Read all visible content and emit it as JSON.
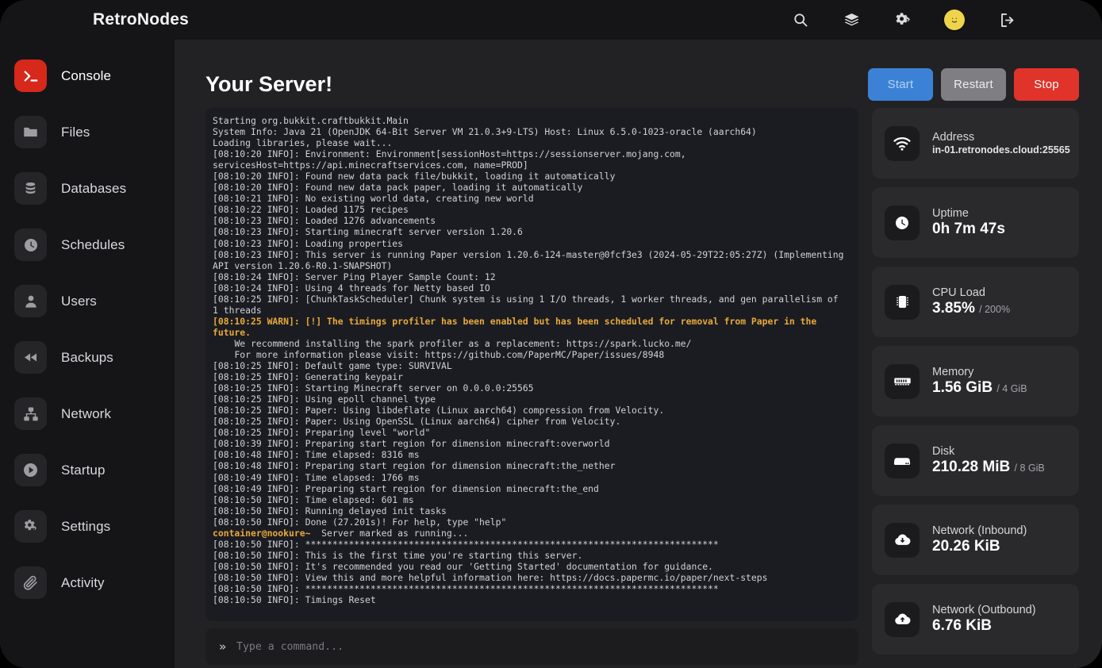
{
  "brand": "RetroNodes",
  "topbar": {
    "icons": [
      {
        "name": "search-icon",
        "label": "Search"
      },
      {
        "name": "layers-icon",
        "label": "Servers"
      },
      {
        "name": "gears-icon",
        "label": "Admin"
      }
    ],
    "avatar": {
      "name": "avatar",
      "label": "Account"
    },
    "logout": {
      "name": "logout-icon",
      "label": "Sign out"
    }
  },
  "sidebar": {
    "items": [
      {
        "label": "Console",
        "icon": "terminal-icon",
        "active": true
      },
      {
        "label": "Files",
        "icon": "folder-icon",
        "active": false
      },
      {
        "label": "Databases",
        "icon": "database-icon",
        "active": false
      },
      {
        "label": "Schedules",
        "icon": "clock-icon",
        "active": false
      },
      {
        "label": "Users",
        "icon": "user-icon",
        "active": false
      },
      {
        "label": "Backups",
        "icon": "rewind-icon",
        "active": false
      },
      {
        "label": "Network",
        "icon": "sitemap-icon",
        "active": false
      },
      {
        "label": "Startup",
        "icon": "play-circle-icon",
        "active": false
      },
      {
        "label": "Settings",
        "icon": "gears-icon",
        "active": false
      },
      {
        "label": "Activity",
        "icon": "paperclip-icon",
        "active": false
      }
    ]
  },
  "main": {
    "title": "Your Server!",
    "buttons": {
      "start": "Start",
      "restart": "Restart",
      "stop": "Stop"
    }
  },
  "console": {
    "lines": [
      {
        "text": "Starting org.bukkit.craftbukkit.Main",
        "type": "info"
      },
      {
        "text": "System Info: Java 21 (OpenJDK 64-Bit Server VM 21.0.3+9-LTS) Host: Linux 6.5.0-1023-oracle (aarch64)",
        "type": "info"
      },
      {
        "text": "Loading libraries, please wait...",
        "type": "info"
      },
      {
        "text": "[08:10:20 INFO]: Environment: Environment[sessionHost=https://sessionserver.mojang.com, servicesHost=https://api.minecraftservices.com, name=PROD]",
        "type": "info"
      },
      {
        "text": "[08:10:20 INFO]: Found new data pack file/bukkit, loading it automatically",
        "type": "info"
      },
      {
        "text": "[08:10:20 INFO]: Found new data pack paper, loading it automatically",
        "type": "info"
      },
      {
        "text": "[08:10:21 INFO]: No existing world data, creating new world",
        "type": "info"
      },
      {
        "text": "[08:10:22 INFO]: Loaded 1175 recipes",
        "type": "info"
      },
      {
        "text": "[08:10:23 INFO]: Loaded 1276 advancements",
        "type": "info"
      },
      {
        "text": "[08:10:23 INFO]: Starting minecraft server version 1.20.6",
        "type": "info"
      },
      {
        "text": "[08:10:23 INFO]: Loading properties",
        "type": "info"
      },
      {
        "text": "[08:10:23 INFO]: This server is running Paper version 1.20.6-124-master@0fcf3e3 (2024-05-29T22:05:27Z) (Implementing API version 1.20.6-R0.1-SNAPSHOT)",
        "type": "info"
      },
      {
        "text": "[08:10:24 INFO]: Server Ping Player Sample Count: 12",
        "type": "info"
      },
      {
        "text": "[08:10:24 INFO]: Using 4 threads for Netty based IO",
        "type": "info"
      },
      {
        "text": "[08:10:25 INFO]: [ChunkTaskScheduler] Chunk system is using 1 I/O threads, 1 worker threads, and gen parallelism of 1 threads",
        "type": "info"
      },
      {
        "text": "[08:10:25 WARN]: [!] The timings profiler has been enabled but has been scheduled for removal from Paper in the future.",
        "type": "warn"
      },
      {
        "text": "    We recommend installing the spark profiler as a replacement: https://spark.lucko.me/",
        "type": "info"
      },
      {
        "text": "    For more information please visit: https://github.com/PaperMC/Paper/issues/8948",
        "type": "info"
      },
      {
        "text": "[08:10:25 INFO]: Default game type: SURVIVAL",
        "type": "info"
      },
      {
        "text": "[08:10:25 INFO]: Generating keypair",
        "type": "info"
      },
      {
        "text": "[08:10:25 INFO]: Starting Minecraft server on 0.0.0.0:25565",
        "type": "info"
      },
      {
        "text": "[08:10:25 INFO]: Using epoll channel type",
        "type": "info"
      },
      {
        "text": "[08:10:25 INFO]: Paper: Using libdeflate (Linux aarch64) compression from Velocity.",
        "type": "info"
      },
      {
        "text": "[08:10:25 INFO]: Paper: Using OpenSSL (Linux aarch64) cipher from Velocity.",
        "type": "info"
      },
      {
        "text": "[08:10:25 INFO]: Preparing level \"world\"",
        "type": "info"
      },
      {
        "text": "[08:10:39 INFO]: Preparing start region for dimension minecraft:overworld",
        "type": "info"
      },
      {
        "text": "[08:10:48 INFO]: Time elapsed: 8316 ms",
        "type": "info"
      },
      {
        "text": "[08:10:48 INFO]: Preparing start region for dimension minecraft:the_nether",
        "type": "info"
      },
      {
        "text": "[08:10:49 INFO]: Time elapsed: 1766 ms",
        "type": "info"
      },
      {
        "text": "[08:10:49 INFO]: Preparing start region for dimension minecraft:the_end",
        "type": "info"
      },
      {
        "text": "[08:10:50 INFO]: Time elapsed: 601 ms",
        "type": "info"
      },
      {
        "text": "[08:10:50 INFO]: Running delayed init tasks",
        "type": "info"
      },
      {
        "text": "[08:10:50 INFO]: Done (27.201s)! For help, type \"help\"",
        "type": "info"
      },
      {
        "text": "Server marked as running...",
        "type": "prompt",
        "prompt": "container@nookure~"
      },
      {
        "text": "[08:10:50 INFO]: ****************************************************************************",
        "type": "info"
      },
      {
        "text": "[08:10:50 INFO]: This is the first time you're starting this server.",
        "type": "info"
      },
      {
        "text": "[08:10:50 INFO]: It's recommended you read our 'Getting Started' documentation for guidance.",
        "type": "info"
      },
      {
        "text": "[08:10:50 INFO]: View this and more helpful information here: https://docs.papermc.io/paper/next-steps",
        "type": "info"
      },
      {
        "text": "[08:10:50 INFO]: ****************************************************************************",
        "type": "info"
      },
      {
        "text": "[08:10:50 INFO]: Timings Reset",
        "type": "info"
      }
    ],
    "command_chevrons": "»",
    "command_placeholder": "Type a command...",
    "command_value": ""
  },
  "stats": [
    {
      "label": "Address",
      "value": "in-01.retronodes.cloud:25565",
      "sub": "",
      "icon": "wifi-icon",
      "small": true
    },
    {
      "label": "Uptime",
      "value": "0h 7m 47s",
      "sub": "",
      "icon": "clock-icon",
      "small": false
    },
    {
      "label": "CPU Load",
      "value": "3.85%",
      "sub": "/ 200%",
      "icon": "cpu-icon",
      "small": false
    },
    {
      "label": "Memory",
      "value": "1.56 GiB",
      "sub": "/ 4 GiB",
      "icon": "memory-icon",
      "small": false
    },
    {
      "label": "Disk",
      "value": "210.28 MiB",
      "sub": "/ 8 GiB",
      "icon": "disk-icon",
      "small": false
    },
    {
      "label": "Network (Inbound)",
      "value": "20.26 KiB",
      "sub": "",
      "icon": "cloud-download-icon",
      "small": false
    },
    {
      "label": "Network (Outbound)",
      "value": "6.76 KiB",
      "sub": "",
      "icon": "cloud-upload-icon",
      "small": false
    }
  ],
  "colors": {
    "accent_red": "#d6281b",
    "start_blue": "#3b82d6",
    "restart_gray": "#7f7f83",
    "stop_red": "#e0332a",
    "warn_amber": "#e8a93a",
    "avatar_yellow": "#efd34b"
  }
}
